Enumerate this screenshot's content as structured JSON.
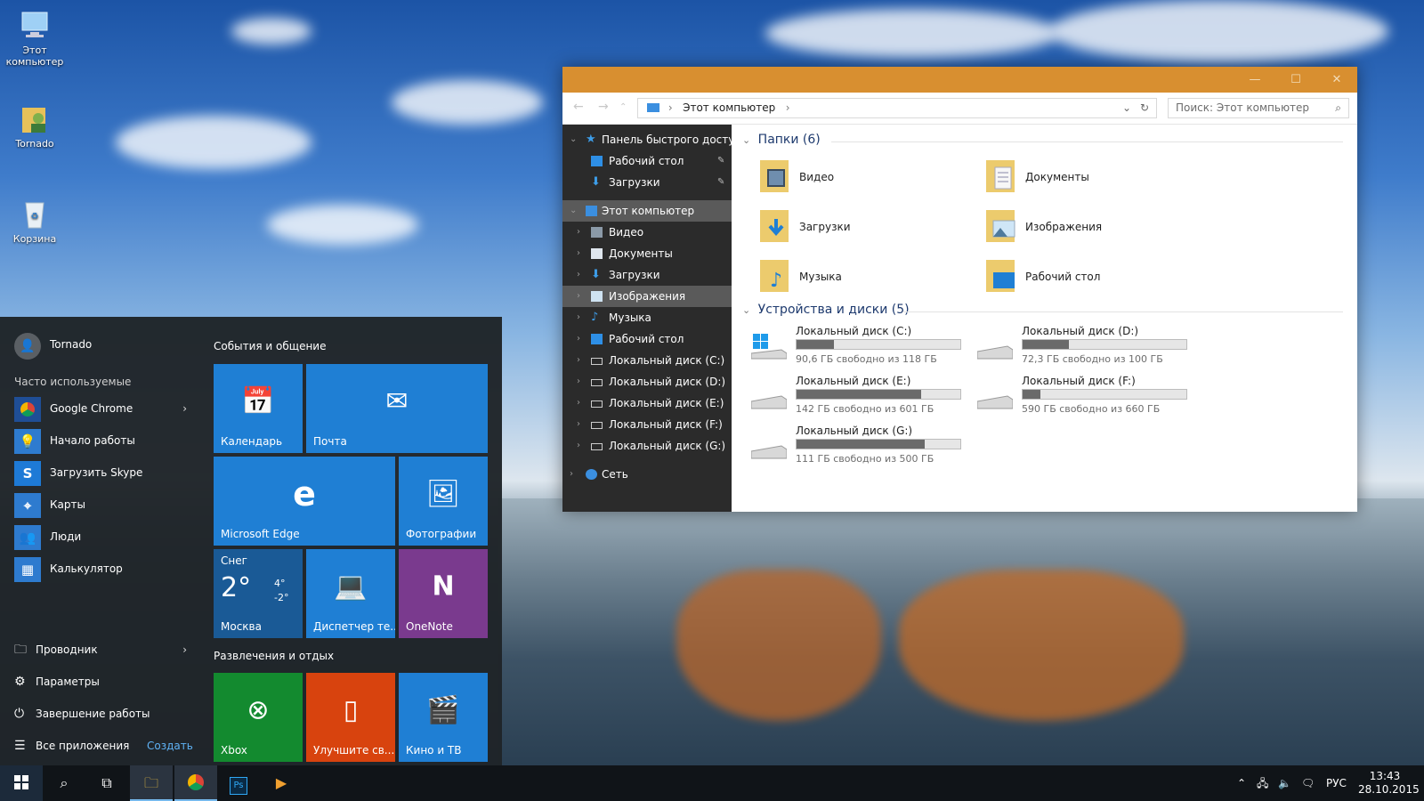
{
  "desktop": {
    "icons": [
      {
        "label": "Этот компьютер",
        "icon": "computer-icon"
      },
      {
        "label": "Tornado",
        "icon": "user-folder-icon"
      },
      {
        "label": "Корзина",
        "icon": "recycle-bin-icon"
      }
    ]
  },
  "explorer": {
    "address": "Этот компьютер",
    "search_placeholder": "Поиск: Этот компьютер",
    "nav": [
      {
        "label": "Панель быстрого доступа",
        "icon": "star-icon"
      },
      {
        "label": "Рабочий стол",
        "icon": "desktop-icon"
      },
      {
        "label": "Загрузки",
        "icon": "download-icon"
      },
      {
        "label": "Этот компьютер",
        "icon": "computer-icon"
      },
      {
        "label": "Видео",
        "icon": "video-icon"
      },
      {
        "label": "Документы",
        "icon": "document-icon"
      },
      {
        "label": "Загрузки",
        "icon": "download-icon"
      },
      {
        "label": "Изображения",
        "icon": "image-icon"
      },
      {
        "label": "Музыка",
        "icon": "music-icon"
      },
      {
        "label": "Рабочий стол",
        "icon": "desktop-icon"
      },
      {
        "label": "Локальный диск (C:)",
        "icon": "drive-icon"
      },
      {
        "label": "Локальный диск (D:)",
        "icon": "drive-icon"
      },
      {
        "label": "Локальный диск (E:)",
        "icon": "drive-icon"
      },
      {
        "label": "Локальный диск (F:)",
        "icon": "drive-icon"
      },
      {
        "label": "Локальный диск (G:)",
        "icon": "drive-icon"
      },
      {
        "label": "Сеть",
        "icon": "network-icon"
      }
    ],
    "folders_title": "Папки (6)",
    "folders": [
      {
        "label": "Видео",
        "icon": "video-folder-icon"
      },
      {
        "label": "Документы",
        "icon": "documents-folder-icon"
      },
      {
        "label": "Загрузки",
        "icon": "downloads-folder-icon"
      },
      {
        "label": "Изображения",
        "icon": "pictures-folder-icon"
      },
      {
        "label": "Музыка",
        "icon": "music-folder-icon"
      },
      {
        "label": "Рабочий стол",
        "icon": "desktop-folder-icon"
      }
    ],
    "drives_title": "Устройства и диски (5)",
    "drives": [
      {
        "name": "Локальный диск (C:)",
        "free": "90,6 ГБ свободно из 118 ГБ",
        "used_fraction": 0.23
      },
      {
        "name": "Локальный диск (D:)",
        "free": "72,3 ГБ свободно из 100 ГБ",
        "used_fraction": 0.28
      },
      {
        "name": "Локальный диск (E:)",
        "free": "142 ГБ свободно из 601 ГБ",
        "used_fraction": 0.76
      },
      {
        "name": "Локальный диск (F:)",
        "free": "590 ГБ свободно из 660 ГБ",
        "used_fraction": 0.11
      },
      {
        "name": "Локальный диск (G:)",
        "free": "111 ГБ свободно из 500 ГБ",
        "used_fraction": 0.78
      }
    ]
  },
  "start": {
    "user": "Tornado",
    "most_used_title": "Часто используемые",
    "most_used": [
      {
        "label": "Google Chrome",
        "icon": "chrome-icon",
        "color": "#1f4e96"
      },
      {
        "label": "Начало работы",
        "icon": "bulb-icon",
        "color": "#2e7bcf"
      },
      {
        "label": "Загрузить Skype",
        "icon": "skype-icon",
        "color": "#1e7ad6"
      },
      {
        "label": "Карты",
        "icon": "maps-icon",
        "color": "#2e7bcf"
      },
      {
        "label": "Люди",
        "icon": "people-icon",
        "color": "#2e7bcf"
      },
      {
        "label": "Калькулятор",
        "icon": "calculator-icon",
        "color": "#2e7bcf"
      }
    ],
    "bottom": [
      {
        "label": "Проводник",
        "icon": "explorer-icon"
      },
      {
        "label": "Параметры",
        "icon": "gear-icon"
      },
      {
        "label": "Завершение работы",
        "icon": "power-icon"
      },
      {
        "label": "Все приложения",
        "icon": "list-icon"
      }
    ],
    "create": "Создать",
    "group1": "События и общение",
    "group2": "Развлечения и отдых",
    "tiles": [
      {
        "label": "Календарь",
        "icon": "calendar-icon",
        "color": "#1f7fd4"
      },
      {
        "label": "Почта",
        "icon": "mail-icon",
        "color": "#1f7fd4"
      },
      {
        "label": "Microsoft Edge",
        "icon": "edge-icon",
        "color": "#1f7fd4"
      },
      {
        "label": "Фотографии",
        "icon": "photos-icon",
        "color": "#1f7fd4"
      },
      {
        "label": "Москва",
        "icon": "weather-icon",
        "color": "#1a5a96"
      },
      {
        "label": "Диспетчер те...",
        "icon": "phone-companion-icon",
        "color": "#1f7fd4"
      },
      {
        "label": "OneNote",
        "icon": "onenote-icon",
        "color": "#7a3a8e"
      },
      {
        "label": "Xbox",
        "icon": "xbox-icon",
        "color": "#138a2f"
      },
      {
        "label": "Улучшите св...",
        "icon": "office-icon",
        "color": "#d8430e"
      },
      {
        "label": "Кино и ТВ",
        "icon": "film-icon",
        "color": "#1f7fd4"
      }
    ],
    "weather": {
      "condition": "Снег",
      "temp": "2°",
      "high": "4°",
      "low": "-2°"
    }
  },
  "taskbar": {
    "lang": "РУС",
    "time": "13:43",
    "date": "28.10.2015"
  }
}
